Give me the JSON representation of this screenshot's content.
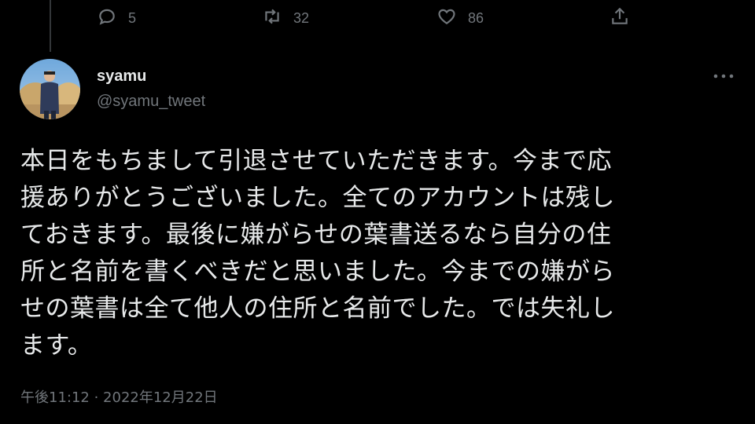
{
  "previous_tweet": {
    "actions": {
      "reply": {
        "icon": "reply-icon",
        "count": "5"
      },
      "retweet": {
        "icon": "retweet-icon",
        "count": "32"
      },
      "like": {
        "icon": "heart-icon",
        "count": "86"
      },
      "share": {
        "icon": "share-icon"
      }
    }
  },
  "tweet": {
    "author": {
      "display_name": "syamu",
      "handle": "@syamu_tweet",
      "avatar_icon": "profile-photo"
    },
    "more_icon": "more-icon",
    "text": "本日をもちまして引退させていただきます。今まで応\n援ありがとうございました。全てのアカウントは残し\nておきます。最後に嫌がらせの葉書送るなら自分の住\n所と名前を書くべきだと思いました。今までの嫌がら\nせの葉書は全て他人の住所と名前でした。では失礼し\nます。",
    "timestamp": "午後11:12 · 2022年12月22日"
  },
  "colors": {
    "background": "#000000",
    "text_primary": "#e7e9ea",
    "text_secondary": "#71767b"
  }
}
